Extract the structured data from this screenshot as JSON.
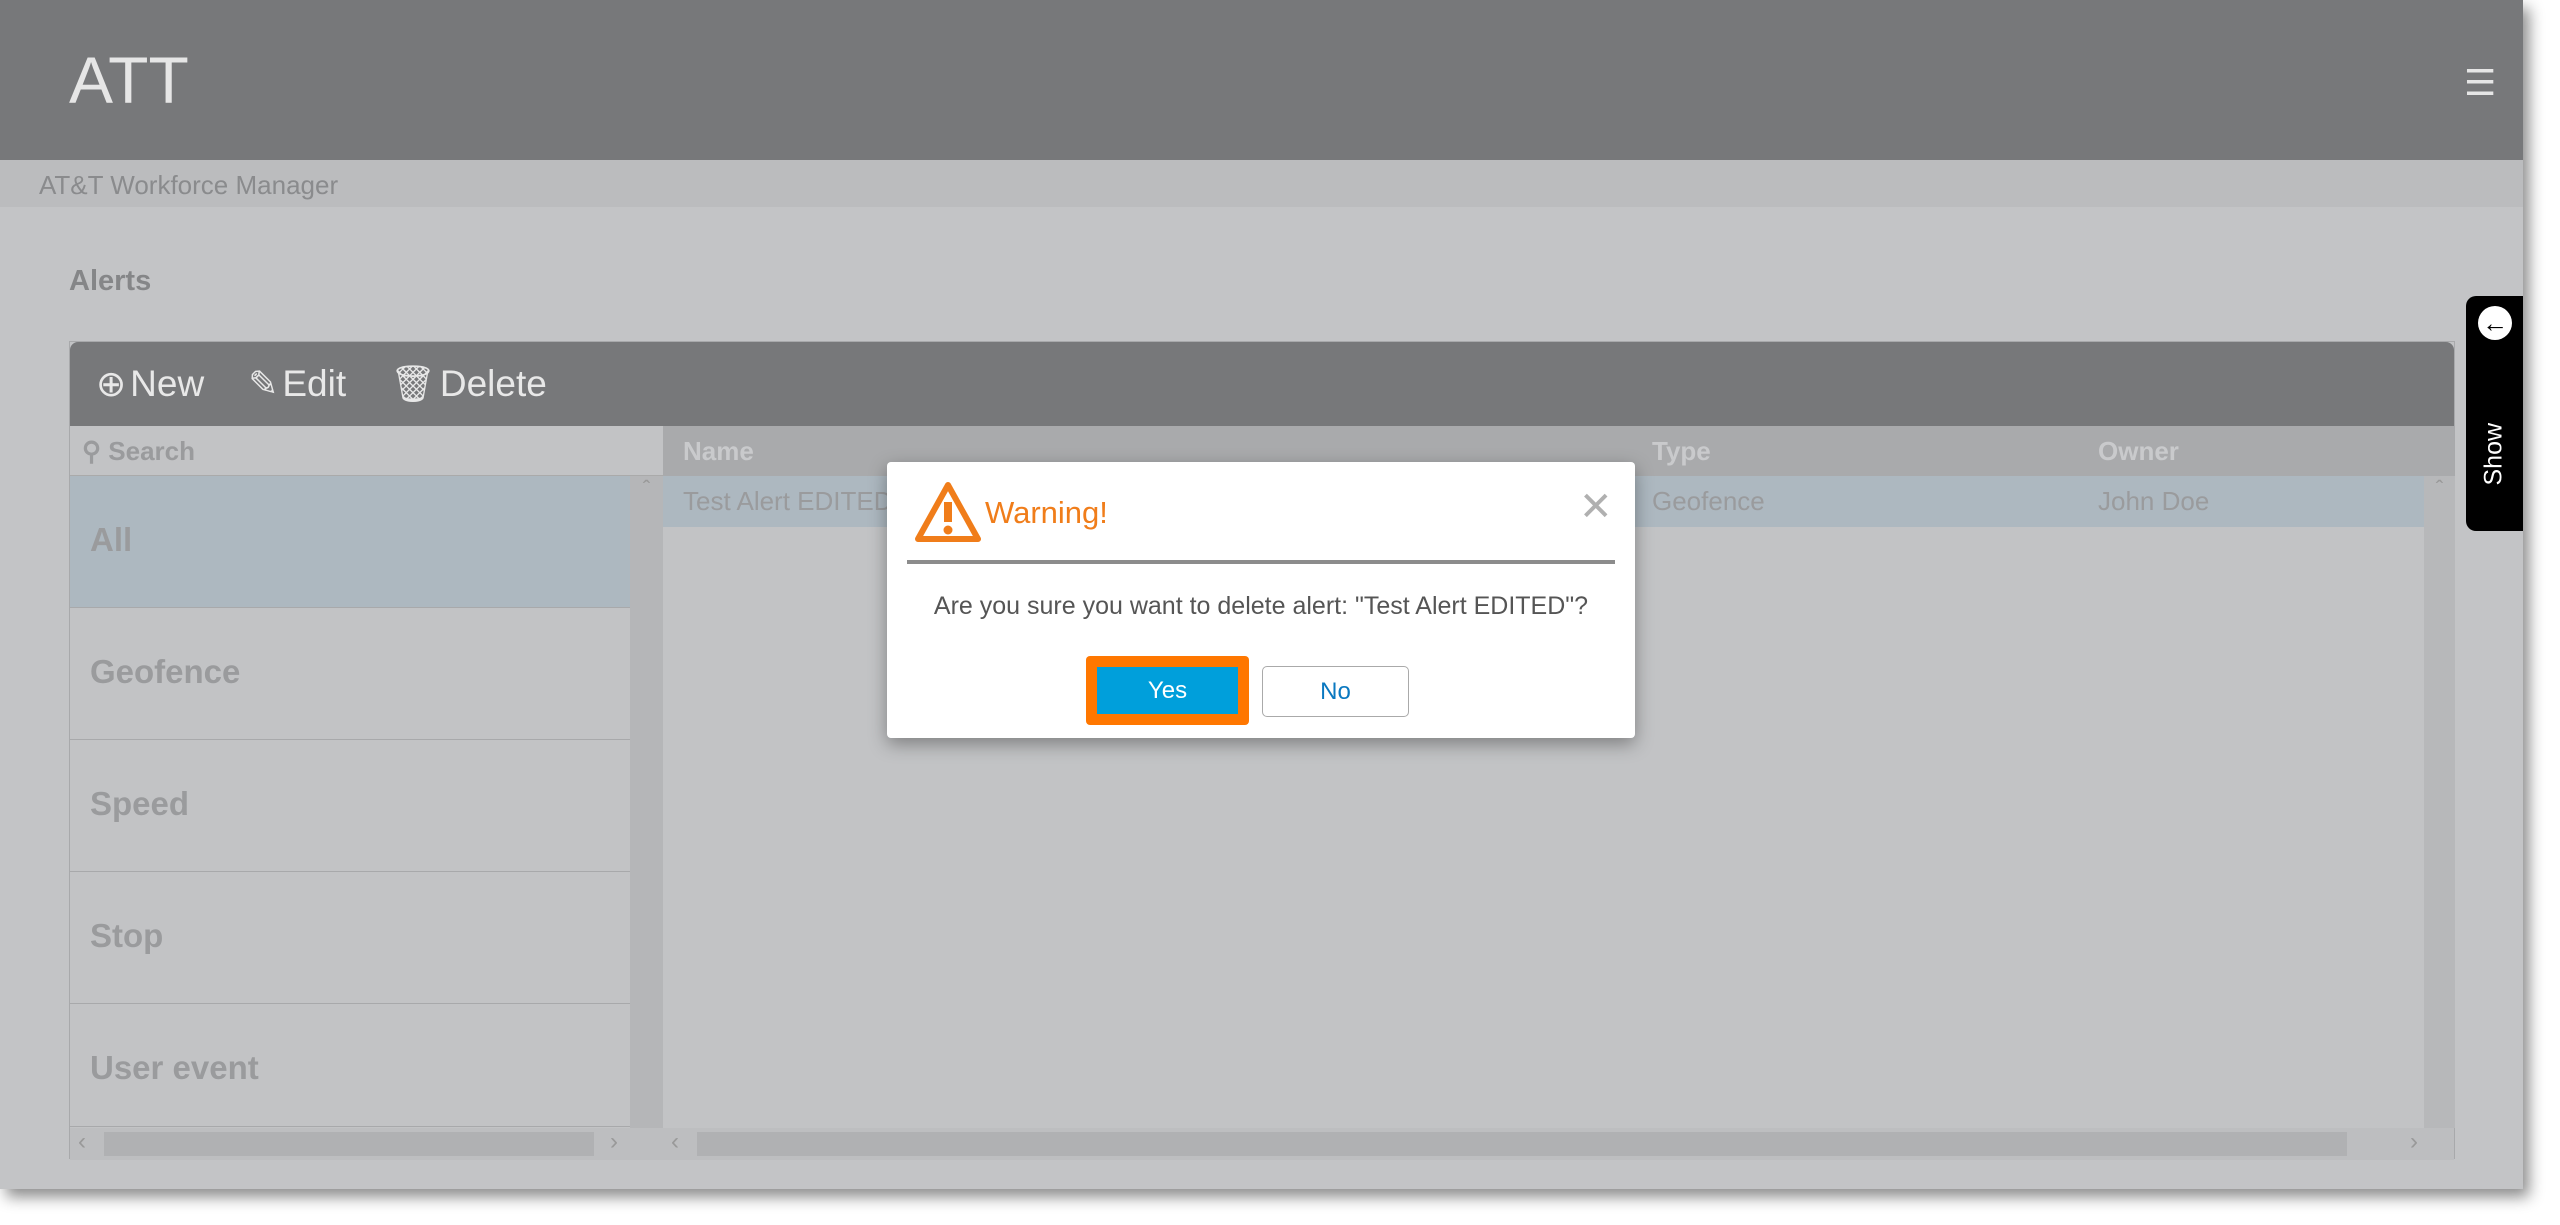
{
  "header": {
    "title": "ATT",
    "menu_icon": "hamburger-icon"
  },
  "subheader": {
    "text": "AT&T Workforce Manager"
  },
  "page": {
    "title": "Alerts"
  },
  "toolbar": {
    "new": "New",
    "edit": "Edit",
    "delete": "Delete"
  },
  "search": {
    "placeholder": "Search"
  },
  "categories": [
    {
      "label": "All",
      "selected": true
    },
    {
      "label": "Geofence"
    },
    {
      "label": "Speed"
    },
    {
      "label": "Stop"
    },
    {
      "label": "User event"
    }
  ],
  "grid": {
    "columns": [
      "Name",
      "Type",
      "Owner"
    ],
    "rows": [
      {
        "name": "Test Alert EDITED",
        "type": "Geofence",
        "owner": "John Doe"
      }
    ]
  },
  "side_tab": {
    "label": "Show"
  },
  "dialog": {
    "title": "Warning!",
    "message": "Are you sure you want to delete alert: \"Test Alert EDITED\"?",
    "yes": "Yes",
    "no": "No",
    "close": "✕"
  },
  "colors": {
    "header": "#77787a",
    "warning": "#f07d1a",
    "primary": "#009fdb",
    "highlight": "#ff7700"
  }
}
